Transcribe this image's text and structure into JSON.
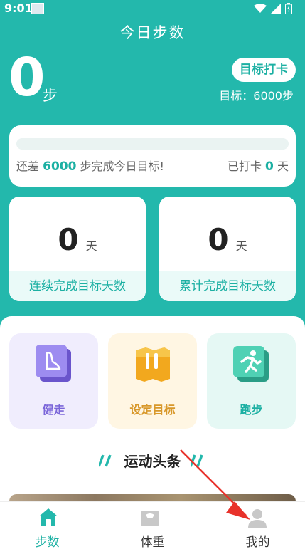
{
  "status_bar": {
    "time": "9:01"
  },
  "header": {
    "title": "今日步数"
  },
  "steps": {
    "count": "0",
    "unit": "步"
  },
  "checkin_button": "目标打卡",
  "goal_text": "目标：6000步",
  "progress": {
    "fraction": 0,
    "prefix": "还差",
    "remaining": "6000",
    "suffix": "步完成今日目标!",
    "checked_prefix": "已打卡",
    "checked_days": "0",
    "checked_unit": "天"
  },
  "stats": [
    {
      "value": "0",
      "unit": "天",
      "label": "连续完成目标天数"
    },
    {
      "value": "0",
      "unit": "天",
      "label": "累计完成目标天数"
    }
  ],
  "features": [
    {
      "label": "健走",
      "icon": "walk-shoe-icon"
    },
    {
      "label": "设定目标",
      "icon": "goal-flag-icon"
    },
    {
      "label": "跑步",
      "icon": "running-person-icon"
    }
  ],
  "news": {
    "title": "运动头条"
  },
  "tabs": [
    {
      "label": "步数",
      "icon": "home-icon",
      "active": true
    },
    {
      "label": "体重",
      "icon": "scale-icon",
      "active": false
    },
    {
      "label": "我的",
      "icon": "user-icon",
      "active": false
    }
  ],
  "colors": {
    "accent": "#23b8ac",
    "walk": "#7b66d9",
    "goal": "#d8982a",
    "arrow": "#e8322b"
  }
}
